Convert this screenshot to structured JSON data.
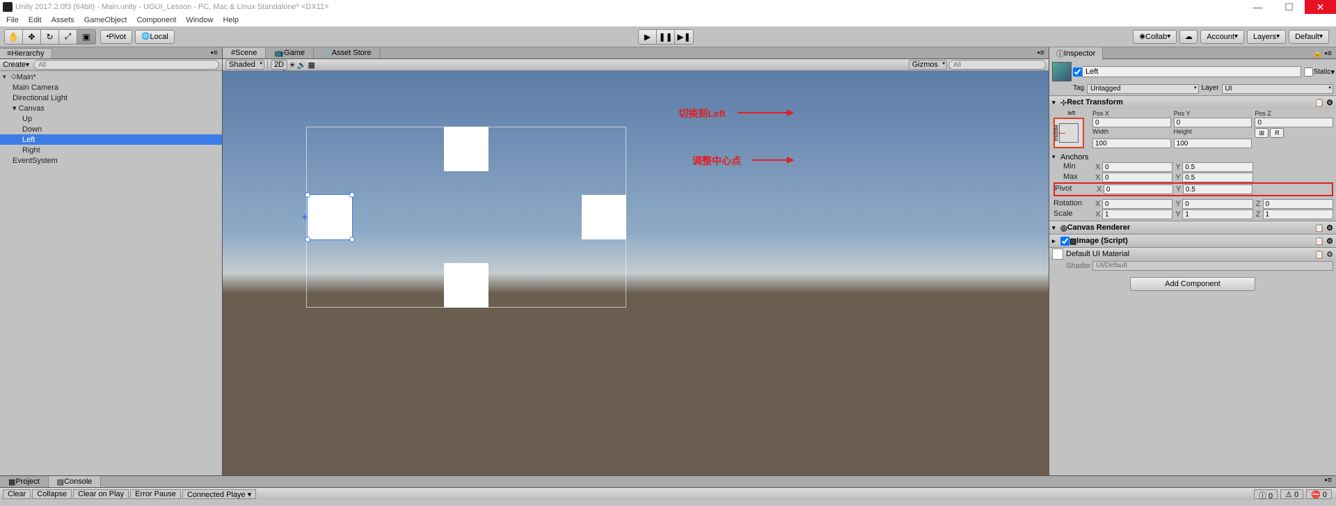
{
  "window": {
    "title": "Unity 2017.2.0f3 (64bit) - Main.unity - UGUI_Lesson - PC, Mac & Linux Standalone* <DX11>"
  },
  "menu": [
    "File",
    "Edit",
    "Assets",
    "GameObject",
    "Component",
    "Window",
    "Help"
  ],
  "toolbar": {
    "pivot": "Pivot",
    "local": "Local",
    "collab": "Collab",
    "account": "Account",
    "layers": "Layers",
    "layout": "Default"
  },
  "hierarchy": {
    "title": "Hierarchy",
    "create": "Create",
    "search": "All",
    "root": "Main*",
    "items": [
      {
        "label": "Main Camera",
        "indent": 1
      },
      {
        "label": "Directional Light",
        "indent": 1
      },
      {
        "label": "Canvas",
        "indent": 1,
        "expand": true
      },
      {
        "label": "Up",
        "indent": 2
      },
      {
        "label": "Down",
        "indent": 2
      },
      {
        "label": "Left",
        "indent": 2,
        "selected": true
      },
      {
        "label": "Right",
        "indent": 2
      },
      {
        "label": "EventSystem",
        "indent": 1
      }
    ]
  },
  "scene": {
    "tabs": [
      "Scene",
      "Game",
      "Asset Store"
    ],
    "shaded": "Shaded",
    "mode2d": "2D",
    "gizmos": "Gizmos",
    "search": "All"
  },
  "inspector": {
    "title": "Inspector",
    "go_name": "Left",
    "static": "Static",
    "tag_label": "Tag",
    "tag_value": "Untagged",
    "layer_label": "Layer",
    "layer_value": "UI",
    "rect_transform": {
      "title": "Rect Transform",
      "anchor_label_v": "middle",
      "anchor_label_h": "left",
      "pos_x_label": "Pos X",
      "pos_x": "0",
      "pos_y_label": "Pos Y",
      "pos_y": "0",
      "pos_z_label": "Pos Z",
      "pos_z": "0",
      "width_label": "Width",
      "width": "100",
      "height_label": "Height",
      "height": "100",
      "anchors_label": "Anchors",
      "min_label": "Min",
      "min_x": "0",
      "min_y": "0.5",
      "max_label": "Max",
      "max_x": "0",
      "max_y": "0.5",
      "pivot_label": "Pivot",
      "pivot_x": "0",
      "pivot_y": "0.5",
      "rotation_label": "Rotation",
      "rot_x": "0",
      "rot_y": "0",
      "rot_z": "0",
      "scale_label": "Scale",
      "scale_x": "1",
      "scale_y": "1",
      "scale_z": "1",
      "blueprint": "⊞",
      "raw": "R"
    },
    "canvas_renderer": "Canvas Renderer",
    "image": {
      "title": "Image (Script)",
      "material": "Default UI Material",
      "shader_label": "Shader",
      "shader": "UI/Default"
    },
    "add_component": "Add Component"
  },
  "annotations": {
    "anchor_preset": "切换到Left",
    "pivot": "调整中心点"
  },
  "bottom": {
    "project": "Project",
    "console": "Console",
    "clear": "Clear",
    "collapse": "Collapse",
    "clear_play": "Clear on Play",
    "error_pause": "Error Pause",
    "connected": "Connected Playe",
    "count0": "0",
    "count1": "0",
    "count2": "0"
  }
}
